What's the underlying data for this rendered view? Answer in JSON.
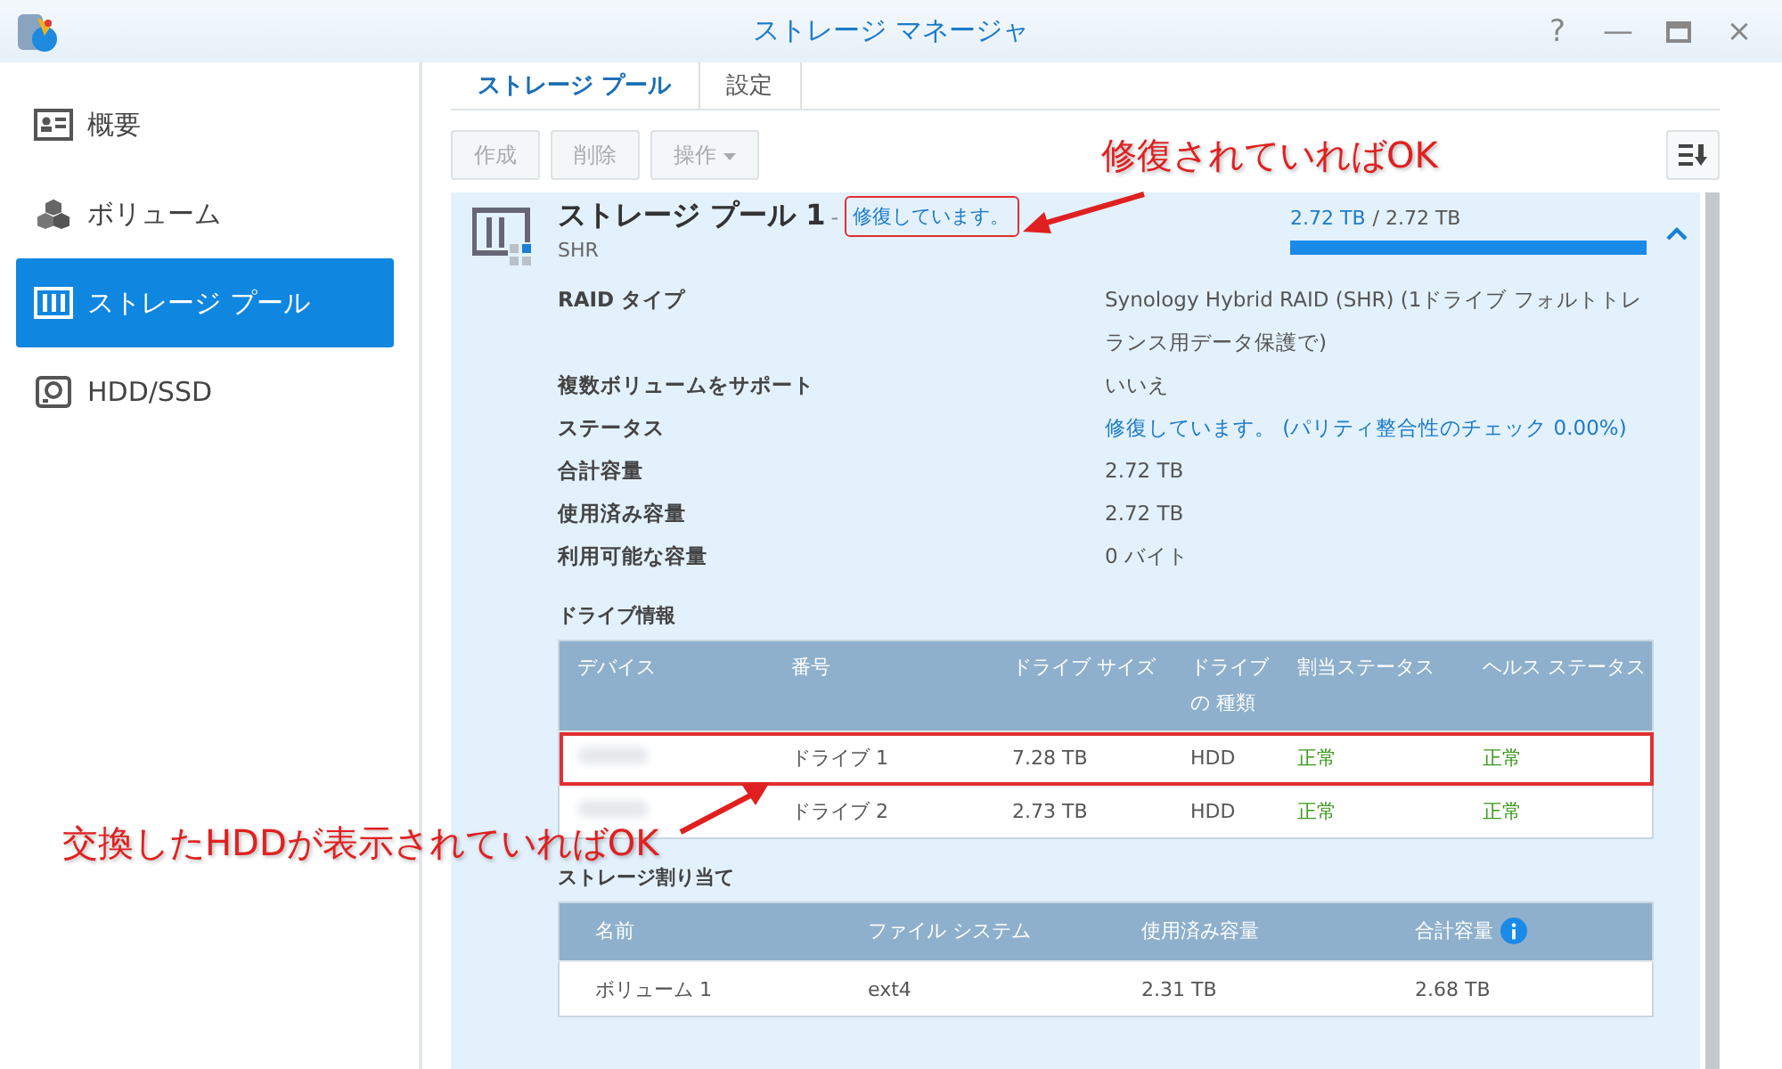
{
  "window": {
    "title": "ストレージ マネージャ",
    "controls": [
      "?",
      "—",
      "×"
    ]
  },
  "sidebar": {
    "items": [
      {
        "label": "概要",
        "kind": "overview",
        "selected": false
      },
      {
        "label": "ボリューム",
        "kind": "volume",
        "selected": false
      },
      {
        "label": "ストレージ プール",
        "kind": "pool",
        "selected": true
      },
      {
        "label": "HDD/SSD",
        "kind": "disk",
        "selected": false
      }
    ]
  },
  "tabs": [
    {
      "label": "ストレージ プール",
      "selected": true
    },
    {
      "label": "設定",
      "selected": false
    }
  ],
  "toolbar": {
    "buttons": [
      {
        "label": "作成",
        "dropdown": false
      },
      {
        "label": "削除",
        "dropdown": false
      },
      {
        "label": "操作",
        "dropdown": true
      }
    ]
  },
  "pool": {
    "name": "ストレージ プール 1",
    "separator": "-",
    "status": "修復しています。",
    "status_highlighted": true,
    "type": "SHR",
    "usage": {
      "used": "2.72 TB",
      "total": "/ 2.72 TB",
      "level": 1.0
    },
    "expanded": true,
    "properties": [
      {
        "label": "RAID タイプ",
        "value": "Synology Hybrid RAID (SHR) (1ドライブ フォルトトレランス用データ保護で)",
        "kind": "text"
      },
      {
        "label": "複数ボリュームをサポート",
        "value": "いいえ",
        "kind": "text"
      },
      {
        "label": "ステータス",
        "value": "修復しています。 (パリティ整合性のチェック 0.00%)",
        "kind": "status"
      },
      {
        "label": "合計容量",
        "value": "2.72 TB",
        "kind": "text"
      },
      {
        "label": "使用済み容量",
        "value": "2.72 TB",
        "kind": "text"
      },
      {
        "label": "利用可能な容量",
        "value": "0 バイト",
        "kind": "text"
      }
    ]
  },
  "drive_info": {
    "title": "ドライブ情報",
    "columns": [
      "デバイス",
      "番号",
      "ドライブ サイズ",
      "ドライブの 種類",
      "割当ステータス",
      "ヘルス ステータス"
    ],
    "rows": [
      {
        "number": "ドライブ 1",
        "size": "7.28 TB",
        "type": "HDD",
        "allocation": "正常",
        "health": "正常",
        "highlighted": true
      },
      {
        "number": "ドライブ 2",
        "size": "2.73 TB",
        "type": "HDD",
        "allocation": "正常",
        "health": "正常",
        "highlighted": false
      }
    ]
  },
  "storage_allocation": {
    "title": "ストレージ割り当て",
    "columns": [
      "名前",
      "ファイル システム",
      "使用済み容量",
      "合計容量"
    ],
    "rows": [
      {
        "name": "ボリューム 1",
        "filesystem": "ext4",
        "used": "2.31 TB",
        "total": "2.68 TB"
      }
    ]
  },
  "annotations": [
    "修復されていればOK",
    "交換したHDDが表示されていればOK"
  ]
}
